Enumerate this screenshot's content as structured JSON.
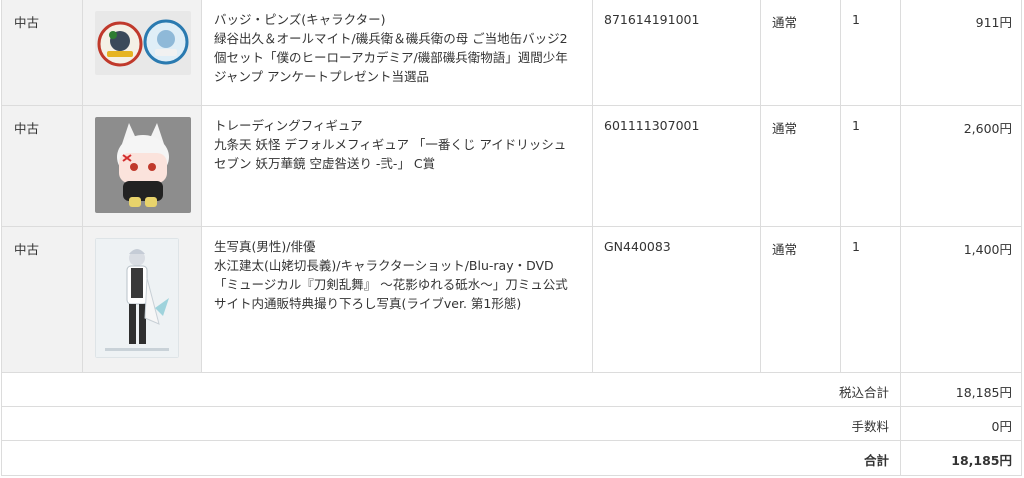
{
  "items": [
    {
      "condition": "中古",
      "category": "バッジ・ピンズ(キャラクター)",
      "description": "緑谷出久＆オールマイト/磯兵衛＆磯兵衛の母 ご当地缶バッジ2個セット「僕のヒーローアカデミア/磯部磯兵衛物語」週間少年ジャンプ アンケートプレゼント当選品",
      "code": "871614191001",
      "type": "通常",
      "qty": "1",
      "price": "911円"
    },
    {
      "condition": "中古",
      "category": "トレーディングフィギュア",
      "description": "九条天 妖怪 デフォルメフィギュア 「一番くじ アイドリッシュセブン 妖万華鏡 空虚咎送り -弐-」 C賞",
      "code": "601111307001",
      "type": "通常",
      "qty": "1",
      "price": "2,600円"
    },
    {
      "condition": "中古",
      "category": "生写真(男性)/俳優",
      "description": "水江建太(山姥切長義)/キャラクターショット/Blu-ray・DVD「ミュージカル『刀剣乱舞』 ～花影ゆれる砥水～」刀ミュ公式サイト内通販特典撮り下ろし写真(ライブver. 第1形態)",
      "code": "GN440083",
      "type": "通常",
      "qty": "1",
      "price": "1,400円"
    }
  ],
  "summary": {
    "tax_included_label": "税込合計",
    "tax_included_value": "18,185円",
    "fee_label": "手数料",
    "fee_value": "0円",
    "total_label": "合計",
    "total_value": "18,185円"
  }
}
